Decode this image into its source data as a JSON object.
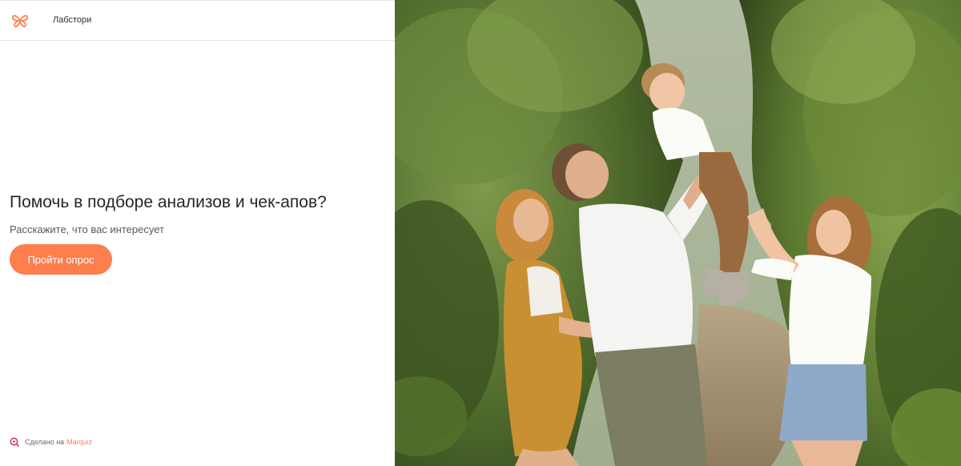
{
  "header": {
    "brand_name": "Лабстори",
    "logo_icon": "butterfly-icon",
    "accent_color": "#fe7e4d"
  },
  "hero": {
    "title": "Помочь в подборе анализов и чек-апов?",
    "subtitle": "Расскажите, что вас интересует",
    "cta_label": "Пройти опрос"
  },
  "footer": {
    "made_with_label": "Сделано на",
    "platform_link": "Marquiz",
    "platform_icon": "marquiz-icon"
  },
  "image": {
    "subject": "family-photo"
  }
}
